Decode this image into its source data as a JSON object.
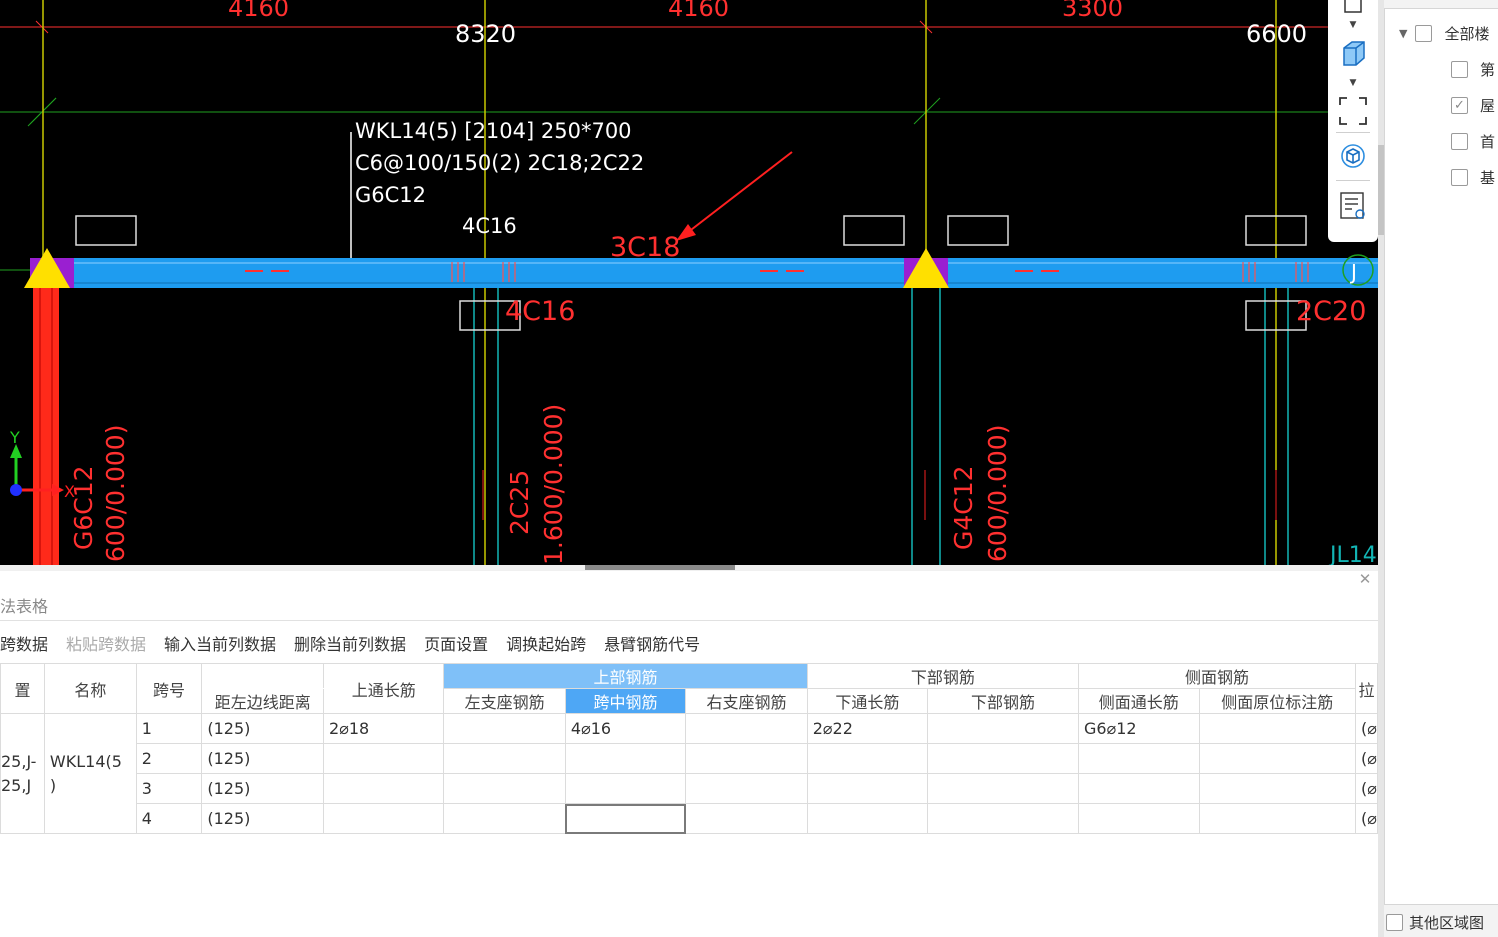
{
  "cad": {
    "dim_top": [
      "4160",
      "8320",
      "4160",
      "3300",
      "6600"
    ],
    "beam_label": [
      "WKL14(5) [2104] 250*700",
      "C6@100/150(2) 2C18;2C22",
      "G6C12"
    ],
    "rebar_top_mid": "4C16",
    "rebar_top_red": "3C18",
    "rebar_bottom_1": "4C16",
    "rebar_bottom_2": "2C20",
    "col_label_1": "G6C12",
    "col_elev_1": "600/0.000)",
    "col_label_2": "2C25",
    "col_elev_2": "1.600/0.000)",
    "col_label_3": "G4C12",
    "col_elev_3": "600/0.000)",
    "corner_label": "J",
    "edge_label": "JL14(",
    "axis_y": "Y",
    "axis_x": "X",
    "colors": {
      "beam": "#1e9cf0",
      "column": "#ff2a1a",
      "axis": "#c8c800",
      "dim": "#ff3030"
    }
  },
  "right_panel": {
    "items": [
      {
        "label": "全部楼",
        "checked": false
      },
      {
        "label": "第",
        "checked": false
      },
      {
        "label": "屋",
        "checked": true
      },
      {
        "label": "首",
        "checked": false
      },
      {
        "label": "基",
        "checked": false
      }
    ],
    "bottom_label": "其他区域图"
  },
  "table_panel": {
    "title": "法表格",
    "toolbar": [
      "跨数据",
      "粘贴跨数据",
      "输入当前列数据",
      "删除当前列数据",
      "页面设置",
      "调换起始跨",
      "悬臂钢筋代号"
    ],
    "group_headers": {
      "top": "上部钢筋",
      "bottom": "下部钢筋",
      "side": "侧面钢筋"
    },
    "headers": {
      "position": "置",
      "name": "名称",
      "span": "跨号",
      "dist": "距左边线距离",
      "top_through": "上通长筋",
      "left_support": "左支座钢筋",
      "mid_span": "跨中钢筋",
      "right_support": "右支座钢筋",
      "bottom_through": "下通长筋",
      "bottom_bar": "下部钢筋",
      "side_through": "侧面通长筋",
      "side_orig": "侧面原位标注筋",
      "extra": "拉"
    },
    "rows": [
      {
        "position": "25,J-\n25,J",
        "name": "WKL14(5\n)",
        "span": "1",
        "dist": "(125)",
        "top_through": "2⌀18",
        "left_support": "",
        "mid_span": "4⌀16",
        "right_support": "",
        "bottom_through": "2⌀22",
        "bottom_bar": "",
        "side_through": "G6⌀12",
        "side_orig": "",
        "extra": "(⌀"
      },
      {
        "span": "2",
        "dist": "(125)",
        "top_through": "",
        "left_support": "",
        "mid_span": "",
        "right_support": "",
        "bottom_through": "",
        "bottom_bar": "",
        "side_through": "",
        "side_orig": "",
        "extra": "(⌀"
      },
      {
        "span": "3",
        "dist": "(125)",
        "top_through": "",
        "left_support": "",
        "mid_span": "",
        "right_support": "",
        "bottom_through": "",
        "bottom_bar": "",
        "side_through": "",
        "side_orig": "",
        "extra": "(⌀"
      },
      {
        "span": "4",
        "dist": "(125)",
        "top_through": "",
        "left_support": "",
        "mid_span": "",
        "right_support": "",
        "bottom_through": "",
        "bottom_bar": "",
        "side_through": "",
        "side_orig": "",
        "extra": "(⌀"
      }
    ]
  }
}
